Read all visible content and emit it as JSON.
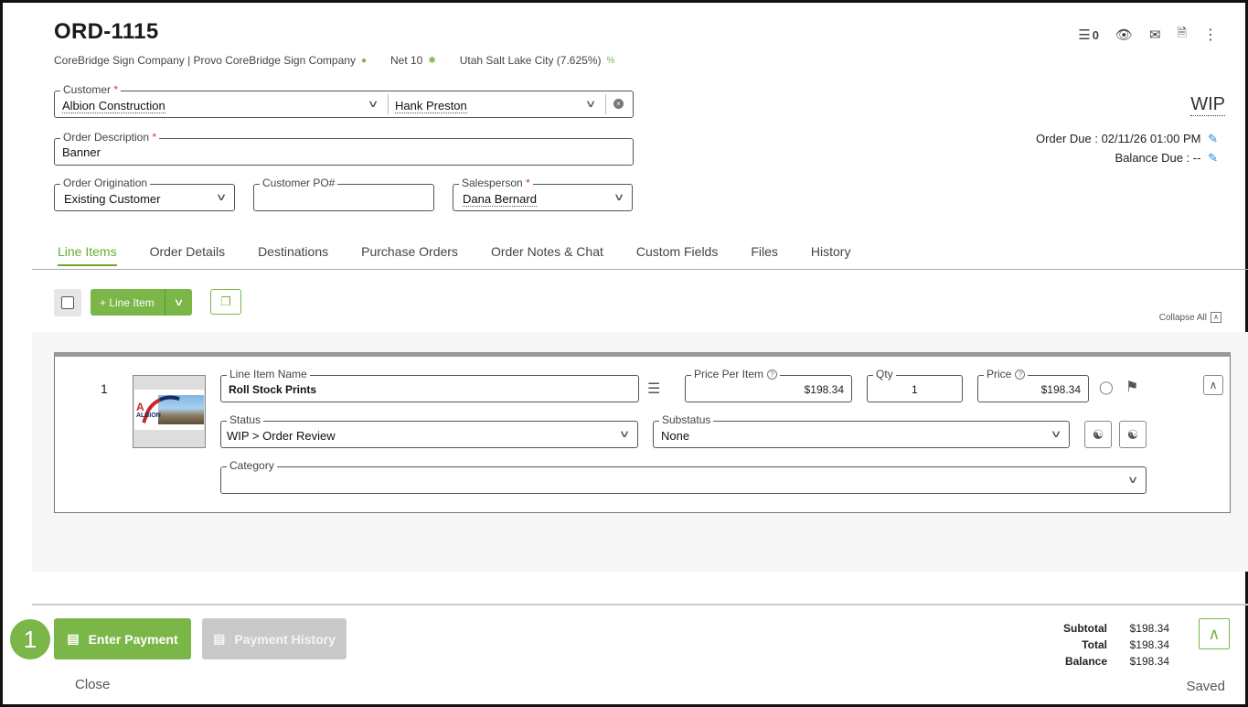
{
  "header": {
    "order_number": "ORD-1115",
    "company": "CoreBridge Sign Company | Provo CoreBridge Sign Company",
    "terms": "Net 10",
    "tax": "Utah Salt Lake City (7.625%)",
    "task_count": "0",
    "status": "WIP",
    "order_due": "Order Due : 02/11/26 01:00 PM",
    "balance_due": "Balance Due : --"
  },
  "form": {
    "customer_label": "Customer",
    "customer_value": "Albion Construction",
    "contact_value": "Hank Preston",
    "description_label": "Order Description",
    "description_value": "Banner",
    "origination_label": "Order Origination",
    "origination_value": "Existing Customer",
    "po_label": "Customer PO#",
    "po_value": "",
    "salesperson_label": "Salesperson",
    "salesperson_value": "Dana Bernard",
    "required_mark": "*"
  },
  "tabs": [
    {
      "label": "Line Items",
      "active": true
    },
    {
      "label": "Order Details"
    },
    {
      "label": "Destinations"
    },
    {
      "label": "Purchase Orders"
    },
    {
      "label": "Order Notes & Chat"
    },
    {
      "label": "Custom Fields"
    },
    {
      "label": "Files"
    },
    {
      "label": "History"
    }
  ],
  "toolbar": {
    "add_line_item": "+ Line Item",
    "collapse_all": "Collapse All"
  },
  "line_item": {
    "number": "1",
    "thumbnail_text": "ALBION",
    "name_label": "Line Item Name",
    "name_value": "Roll Stock Prints",
    "ppi_label": "Price Per Item",
    "ppi_value": "$198.34",
    "qty_label": "Qty",
    "qty_value": "1",
    "price_label": "Price",
    "price_value": "$198.34",
    "status_label": "Status",
    "status_value": "WIP > Order Review",
    "substatus_label": "Substatus",
    "substatus_value": "None",
    "category_label": "Category",
    "category_value": ""
  },
  "footer": {
    "step_number": "1",
    "enter_payment": "Enter Payment",
    "payment_history": "Payment History",
    "close": "Close",
    "subtotal_label": "Subtotal",
    "subtotal_value": "$198.34",
    "total_label": "Total",
    "total_value": "$198.34",
    "balance_label": "Balance",
    "balance_value": "$198.34",
    "saved": "Saved"
  },
  "colors": {
    "accent_green": "#7ab648",
    "edit_blue": "#1e88e5",
    "required_red": "#d33333"
  },
  "icons": [
    "location-pin-icon",
    "asterisk-icon",
    "percent-icon",
    "checklist-icon",
    "eye-icon",
    "mail-icon",
    "pdf-icon",
    "more-vert-icon",
    "pencil-icon",
    "clear-icon",
    "copy-icon",
    "list-icon",
    "lock-icon",
    "flag-icon",
    "handshake-icon",
    "chevron-up-icon",
    "money-icon",
    "receipt-icon"
  ]
}
